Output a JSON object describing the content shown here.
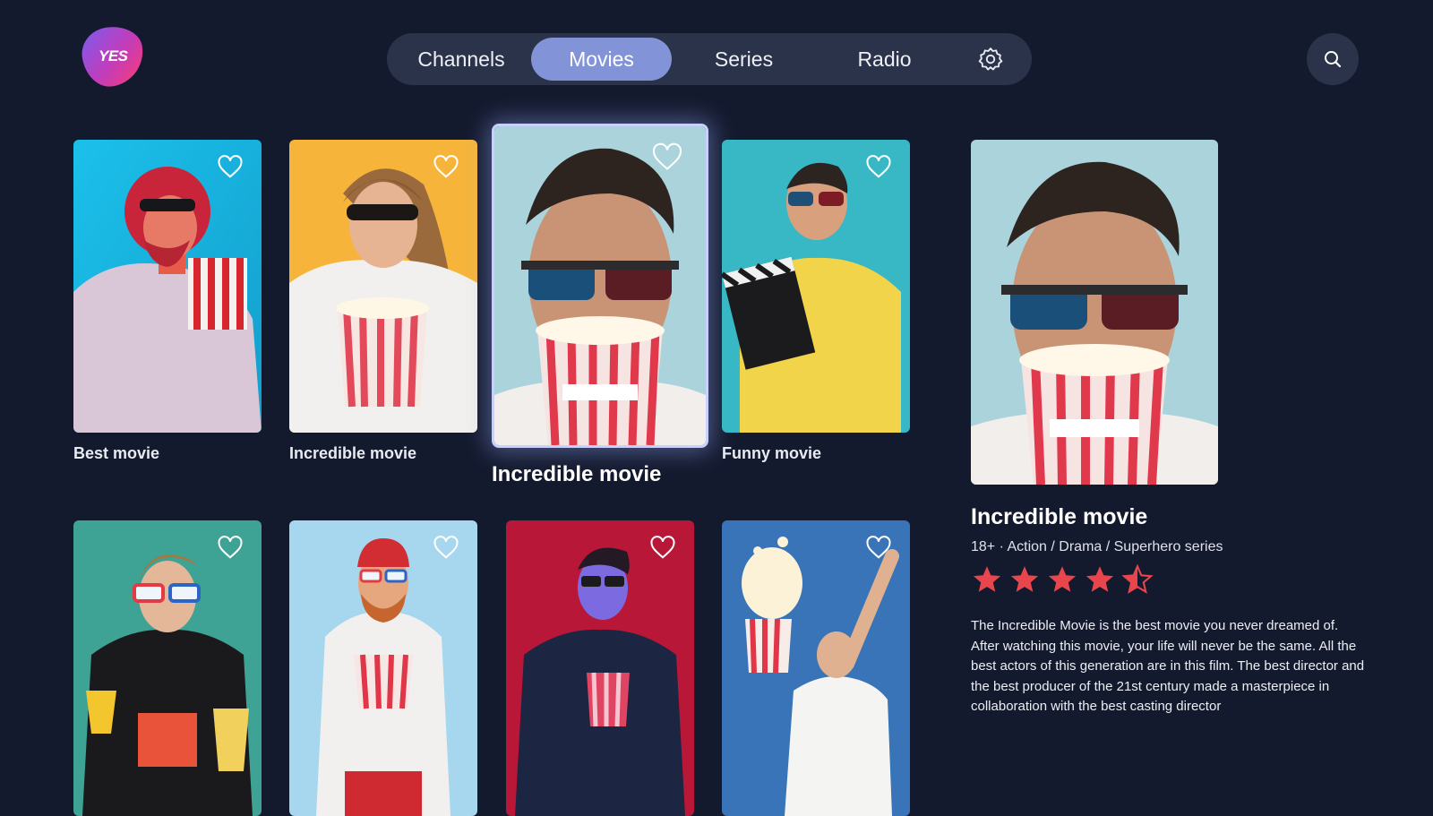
{
  "app": {
    "logo_text": "YES",
    "brand_colors": {
      "start": "#7a5cf0",
      "mid": "#c43cb8",
      "end": "#ff3d6e"
    }
  },
  "nav": {
    "tabs": [
      {
        "label": "Channels",
        "active": false
      },
      {
        "label": "Movies",
        "active": true
      },
      {
        "label": "Series",
        "active": false
      },
      {
        "label": "Radio",
        "active": false
      }
    ],
    "settings_icon": "gear-icon",
    "search_icon": "search-icon"
  },
  "grid": {
    "cards": [
      {
        "title": "Best movie",
        "favorite": false,
        "focused": false
      },
      {
        "title": "Incredible movie",
        "favorite": false,
        "focused": false
      },
      {
        "title": "Incredible movie",
        "favorite": false,
        "focused": true
      },
      {
        "title": "Funny movie",
        "favorite": false,
        "focused": false
      },
      {
        "title": "",
        "favorite": false,
        "focused": false
      },
      {
        "title": "",
        "favorite": false,
        "focused": false
      },
      {
        "title": "",
        "favorite": false,
        "focused": false
      },
      {
        "title": "",
        "favorite": false,
        "focused": false
      }
    ]
  },
  "detail": {
    "title": "Incredible movie",
    "meta": "18+ · Action / Drama / Superhero series",
    "rating": 4.5,
    "rating_max": 5,
    "star_color": "#e8464c",
    "description": "The Incredible Movie is the best movie you never dreamed of. After watching this movie, your life will never be the same. All the best actors of this generation are in this film. The best director and the best producer of the 21st century made a masterpiece in collaboration with the best casting director"
  }
}
